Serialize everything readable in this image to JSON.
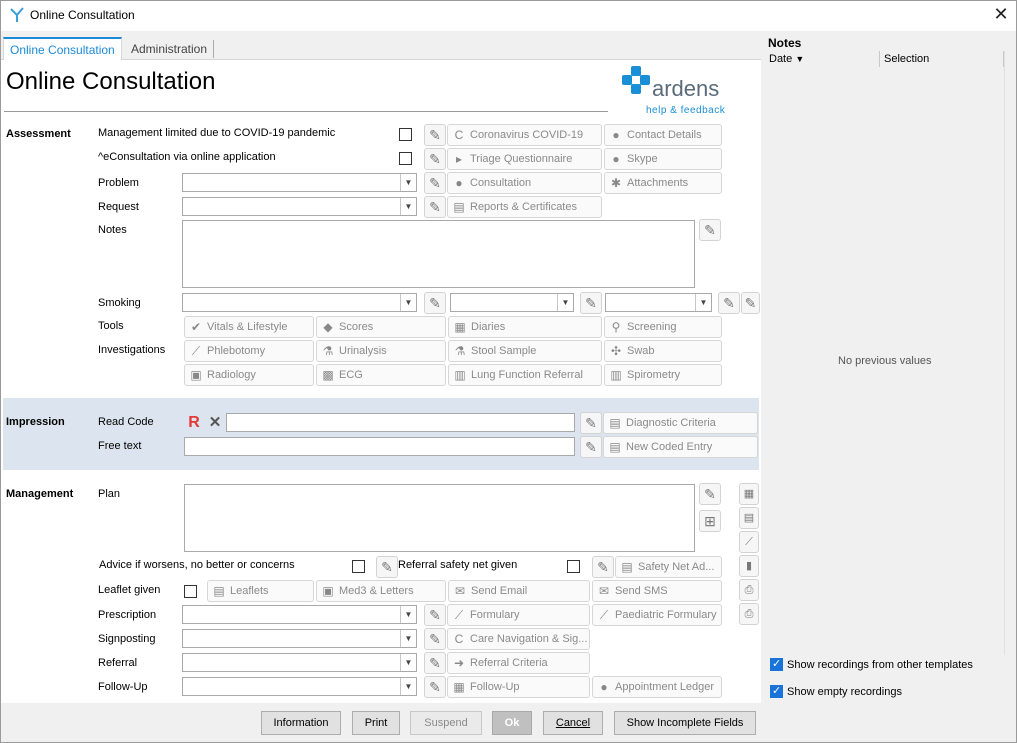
{
  "window": {
    "title": "Online Consultation",
    "close_glyph": "✕"
  },
  "tabs": [
    {
      "label": "Online Consultation",
      "active": true
    },
    {
      "label": "Administration",
      "active": false
    }
  ],
  "page_title": "Online Consultation",
  "logo": {
    "brand": "ardens",
    "sub": "help & feedback"
  },
  "assessment": {
    "heading": "Assessment",
    "rows": [
      {
        "label": "Management limited due to COVID-19 pandemic"
      },
      {
        "label": "^eConsultation via online application"
      },
      {
        "label": "Problem"
      },
      {
        "label": "Request"
      },
      {
        "label": "Notes"
      },
      {
        "label": "Smoking"
      },
      {
        "label": "Tools"
      },
      {
        "label": "Investigations"
      }
    ],
    "buttons": {
      "covid": "Coronavirus COVID-19",
      "contact": "Contact Details",
      "triage": "Triage Questionnaire",
      "skype": "Skype",
      "consultation": "Consultation",
      "attachments": "Attachments",
      "reports": "Reports & Certificates",
      "vitals": "Vitals & Lifestyle",
      "scores": "Scores",
      "diaries": "Diaries",
      "screening": "Screening",
      "phlebotomy": "Phlebotomy",
      "urinalysis": "Urinalysis",
      "stool": "Stool Sample",
      "swab": "Swab",
      "radiology": "Radiology",
      "ecg": "ECG",
      "lung": "Lung Function Referral",
      "spirometry": "Spirometry"
    }
  },
  "impression": {
    "heading": "Impression",
    "read_code_label": "Read Code",
    "free_text_label": "Free text",
    "diagnostic": "Diagnostic Criteria",
    "new_coded": "New Coded Entry"
  },
  "management": {
    "heading": "Management",
    "plan_label": "Plan",
    "advice_label": "Advice if worsens, no better or concerns",
    "safety_label": "Referral safety net given",
    "safety_btn": "Safety Net Ad...",
    "leaflet_label": "Leaflet given",
    "leaflets": "Leaflets",
    "med3": "Med3 & Letters",
    "email": "Send Email",
    "sms": "Send SMS",
    "prescription_label": "Prescription",
    "formulary": "Formulary",
    "paed": "Paediatric Formulary",
    "signposting_label": "Signposting",
    "care_nav": "Care Navigation & Sig...",
    "referral_label": "Referral",
    "referral_criteria": "Referral Criteria",
    "followup_label": "Follow-Up",
    "followup": "Follow-Up",
    "appointment": "Appointment Ledger"
  },
  "footer": {
    "information": "Information",
    "print": "Print",
    "suspend": "Suspend",
    "ok": "Ok",
    "cancel": "Cancel",
    "incomplete": "Show Incomplete Fields"
  },
  "notes_panel": {
    "title": "Notes",
    "col_date": "Date",
    "col_selection": "Selection",
    "empty": "No previous values",
    "show_other": "Show recordings from other templates",
    "show_empty": "Show empty recordings"
  },
  "colors": {
    "accent": "#1c8ad8",
    "impression_band": "#dce5ef",
    "logo_blue": "#1a8fd6",
    "read_code_red": "#e53935"
  }
}
